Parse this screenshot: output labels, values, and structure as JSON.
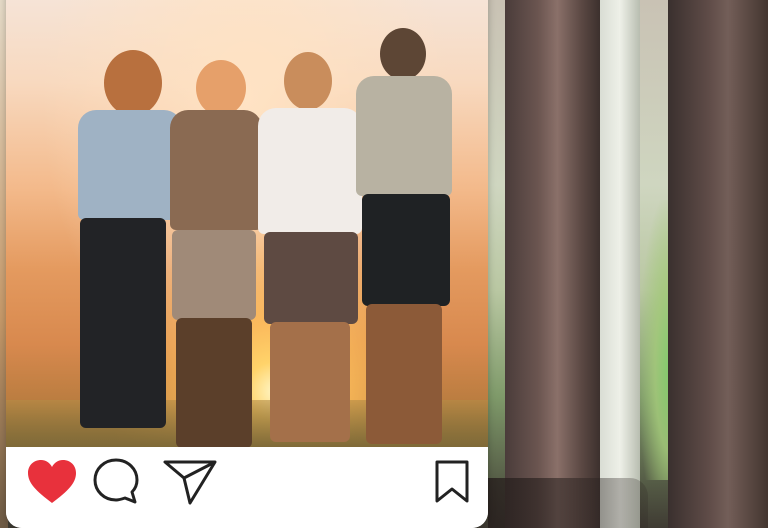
{
  "post": {
    "photo_alt": "",
    "actions": {
      "like_icon": "heart-icon",
      "comment_icon": "comment-icon",
      "share_icon": "send-icon",
      "save_icon": "bookmark-icon",
      "like_color": "#e8313c",
      "icon_stroke": "#222222",
      "liked": true
    }
  }
}
